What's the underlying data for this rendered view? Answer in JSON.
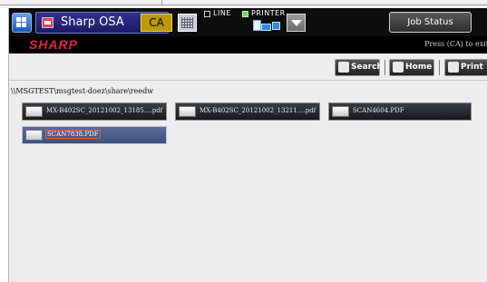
{
  "statusbar": {
    "app_title": "Sharp OSA",
    "ca_label": "CA",
    "line_label": "LINE",
    "printer_label": "PRINTER",
    "job_status_label": "Job Status",
    "line_checked": false,
    "printer_active": true
  },
  "header": {
    "brand": "SHARP",
    "hint": "Press (CA) to exit"
  },
  "toolbar": {
    "search_label": "Search",
    "home_label": "Home",
    "print_label": "Print"
  },
  "browser": {
    "path": "\\\\MSGTEST\\msgtest-doez\\share\\reedw",
    "files": [
      {
        "name": "MX-B402SC_20121002_13185....pdf",
        "selected": false
      },
      {
        "name": "MX-B402SC_20121002_13211....pdf",
        "selected": false
      },
      {
        "name": "SCAN4604.PDF",
        "selected": false
      },
      {
        "name": "SCAN7838.PDF",
        "selected": true
      }
    ]
  },
  "colors": {
    "statusbar_bg": "#0d0d0d",
    "osa_box": "#1b1b66",
    "ca_button": "#bd9a00",
    "brand_red": "#e0282f",
    "selected_file": "#4a5a88",
    "page_bg": "#ededed"
  }
}
